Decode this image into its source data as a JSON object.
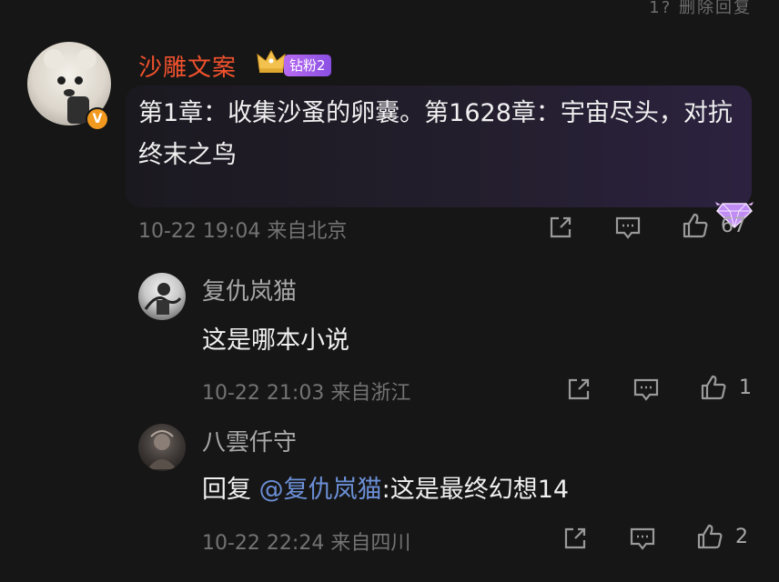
{
  "top_status": "1?  删除回复",
  "comments": [
    {
      "user_name": "沙雕文案",
      "fan_badge": "钻粉2",
      "verified_badge": "V",
      "text": "第1章：收集沙蚤的卵囊。第1628章：宇宙尽头，对抗终末之鸟",
      "meta": "10-22 19:04 来自北京",
      "like_count": "67"
    },
    {
      "user_name": "复仇岚猫",
      "text": "这是哪本小说",
      "meta": "10-22 21:03 来自浙江",
      "like_count": "1"
    },
    {
      "user_name": "八雲仟守",
      "reply_prefix": "回复 ",
      "mention": "@复仇岚猫",
      "reply_text": ":这是最终幻想14",
      "meta": "10-22 22:24 来自四川",
      "like_count": "2"
    }
  ],
  "icons": {
    "share": "share-icon",
    "comment": "comment-icon",
    "like": "thumbs-up-icon"
  },
  "colors": {
    "background": "#161616",
    "username_highlight": "#f3522e",
    "mention": "#6b8fd6",
    "fan_badge": "#a25cec",
    "meta": "#737373"
  }
}
